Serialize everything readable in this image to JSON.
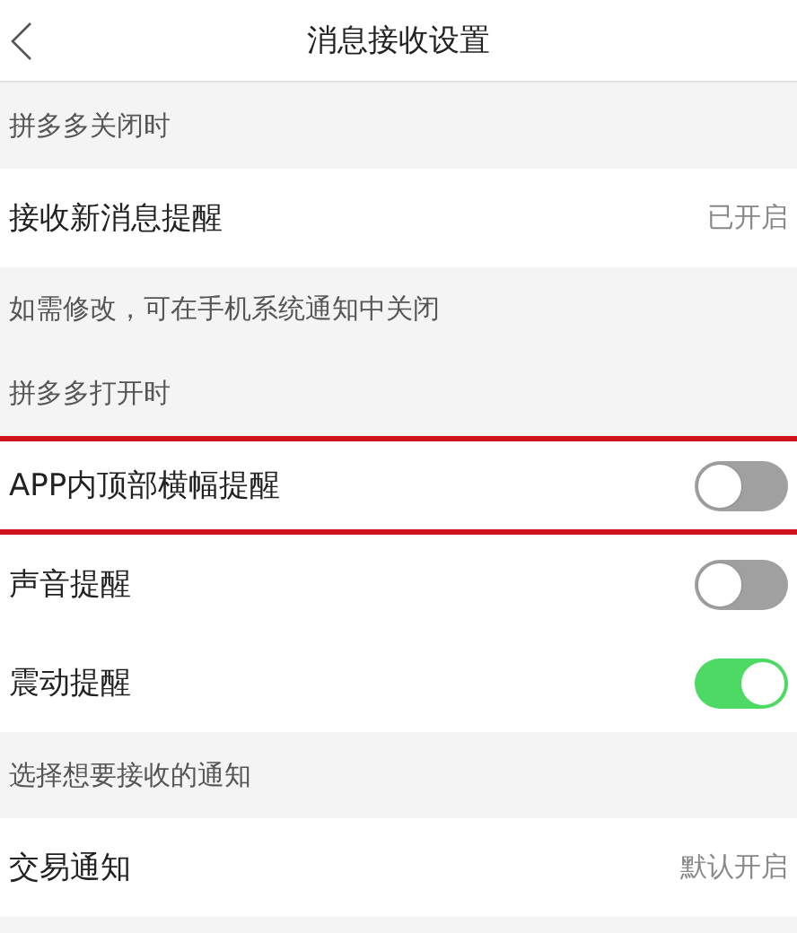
{
  "header": {
    "title": "消息接收设置"
  },
  "sections": [
    {
      "header": "拼多多关闭时",
      "rows": [
        {
          "kind": "value",
          "label": "接收新消息提醒",
          "value": "已开启",
          "highlighted": false
        }
      ],
      "note": "如需修改，可在手机系统通知中关闭"
    },
    {
      "header": "拼多多打开时",
      "rows": [
        {
          "kind": "switch",
          "label": "APP内顶部横幅提醒",
          "on": false,
          "highlighted": true
        },
        {
          "kind": "switch",
          "label": "声音提醒",
          "on": false,
          "highlighted": false
        },
        {
          "kind": "switch",
          "label": "震动提醒",
          "on": true,
          "highlighted": false
        }
      ]
    },
    {
      "header": "选择想要接收的通知",
      "rows": [
        {
          "kind": "value",
          "label": "交易通知",
          "value": "默认开启",
          "highlighted": false
        }
      ]
    }
  ]
}
